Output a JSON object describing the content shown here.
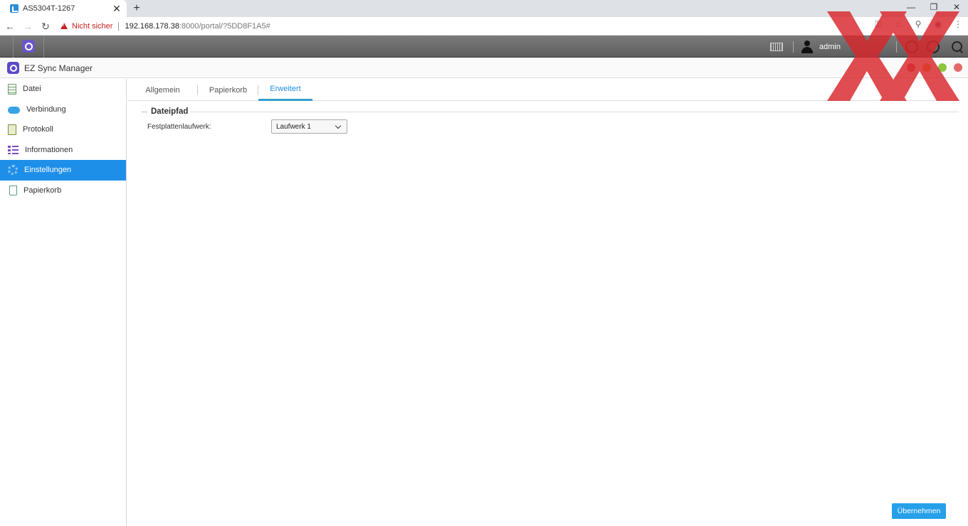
{
  "browser": {
    "tab_title": "AS5304T-1267",
    "insecure_label": "Nicht sicher",
    "url_host": "192.168.178.38",
    "url_rest": ":8000/portal/?5DD8F1A5#",
    "icons": [
      "key-icon",
      "star-icon",
      "extension-icon",
      "profile-icon",
      "menu-icon"
    ]
  },
  "adm": {
    "username": "admin"
  },
  "app": {
    "title": "EZ Sync Manager",
    "window_dot_colors": [
      "#e45f5f",
      "#e8a43a",
      "#8cc63f",
      "#e46a6a"
    ]
  },
  "sidebar": {
    "items": [
      {
        "label": "Datei",
        "icon": "file-icon"
      },
      {
        "label": "Verbindung",
        "icon": "cloud-icon"
      },
      {
        "label": "Protokoll",
        "icon": "log-icon"
      },
      {
        "label": "Informationen",
        "icon": "info-list-icon"
      },
      {
        "label": "Einstellungen",
        "icon": "gear-icon",
        "active": true
      },
      {
        "label": "Papierkorb",
        "icon": "trash-icon"
      }
    ]
  },
  "main": {
    "tabs": [
      {
        "label": "Allgemein"
      },
      {
        "label": "Papierkorb"
      },
      {
        "label": "Erweitert",
        "active": true
      }
    ],
    "section_title": "Dateipfad",
    "field_label": "Festplattenlaufwerk:",
    "drive_select_value": "Laufwerk 1",
    "apply_label": "Übernehmen"
  },
  "colors": {
    "accent": "#1e8fe9",
    "watermark": "#d9262b"
  }
}
